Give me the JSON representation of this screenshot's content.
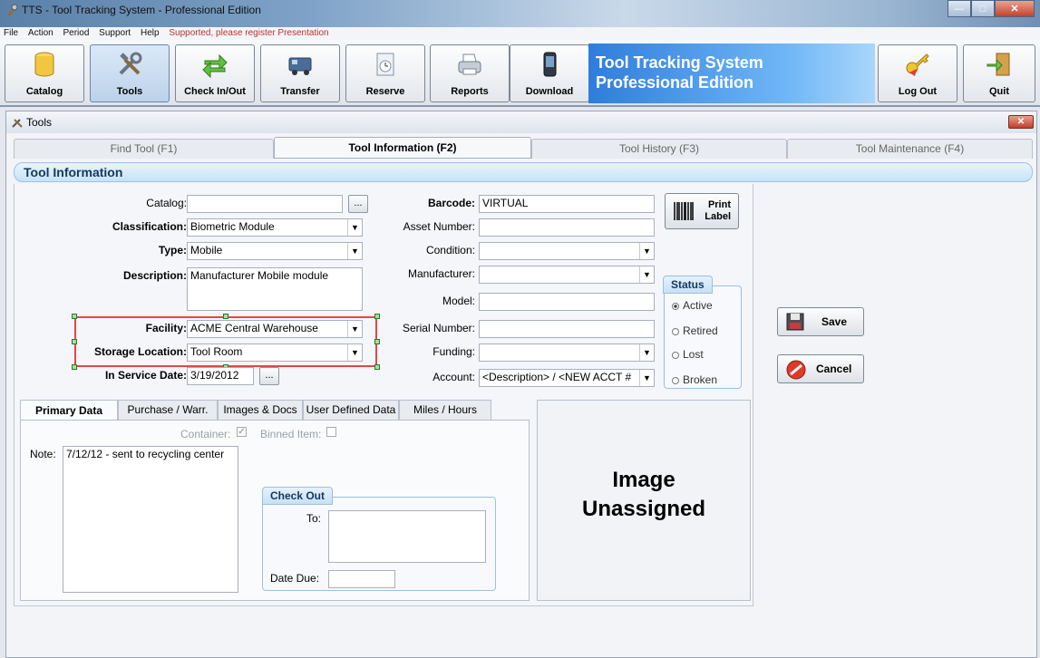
{
  "window": {
    "title": "TTS - Tool Tracking System - Professional Edition"
  },
  "menubar": {
    "items": [
      "File",
      "Action",
      "Period",
      "Support",
      "Help"
    ],
    "overlay_text": "Supported, please register Presentation"
  },
  "toolbar": {
    "catalog": "Catalog",
    "tools": "Tools",
    "checkinout": "Check In/Out",
    "transfer": "Transfer",
    "reserve": "Reserve",
    "reports": "Reports",
    "download": "Download",
    "logout": "Log Out",
    "quit": "Quit",
    "brand_line1": "Tool Tracking System",
    "brand_line2": "Professional Edition"
  },
  "child": {
    "title": "Tools"
  },
  "tabs": [
    "Find Tool (F1)",
    "Tool Information (F2)",
    "Tool History (F3)",
    "Tool Maintenance (F4)"
  ],
  "section_title": "Tool Information",
  "form": {
    "catalog_label": "Catalog:",
    "catalog_value": "",
    "classification_label": "Classification:",
    "classification_value": "Biometric Module",
    "type_label": "Type:",
    "type_value": "Mobile",
    "description_label": "Description:",
    "description_value": "Manufacturer Mobile module",
    "facility_label": "Facility:",
    "facility_value": "ACME Central Warehouse",
    "storage_label": "Storage Location:",
    "storage_value": "Tool Room",
    "inservice_label": "In Service Date:",
    "inservice_value": "3/19/2012",
    "barcode_label": "Barcode:",
    "barcode_value": "VIRTUAL",
    "asset_label": "Asset Number:",
    "asset_value": "",
    "condition_label": "Condition:",
    "condition_value": "",
    "manufacturer_label": "Manufacturer:",
    "manufacturer_value": "",
    "model_label": "Model:",
    "model_value": "",
    "serial_label": "Serial Number:",
    "serial_value": "",
    "funding_label": "Funding:",
    "funding_value": "",
    "account_label": "Account:",
    "account_value": "<Description> / <NEW ACCT #",
    "print_label_line1": "Print",
    "print_label_line2": "Label",
    "dots": "..."
  },
  "status": {
    "title": "Status",
    "options": [
      "Active",
      "Retired",
      "Lost",
      "Broken"
    ],
    "selected": "Active"
  },
  "actions": {
    "save": "Save",
    "cancel": "Cancel"
  },
  "subtabs": [
    "Primary Data",
    "Purchase / Warr.",
    "Images & Docs",
    "User Defined Data",
    "Miles / Hours"
  ],
  "primary": {
    "container_label": "Container:",
    "binned_label": "Binned Item:",
    "container_checked": true,
    "binned_checked": false,
    "note_label": "Note:",
    "note_value": "7/12/12 - sent to recycling center"
  },
  "checkout": {
    "title": "Check Out",
    "to_label": "To:",
    "to_value": "",
    "date_due_label": "Date Due:",
    "date_due_value": ""
  },
  "image": {
    "line1": "Image",
    "line2": "Unassigned"
  }
}
